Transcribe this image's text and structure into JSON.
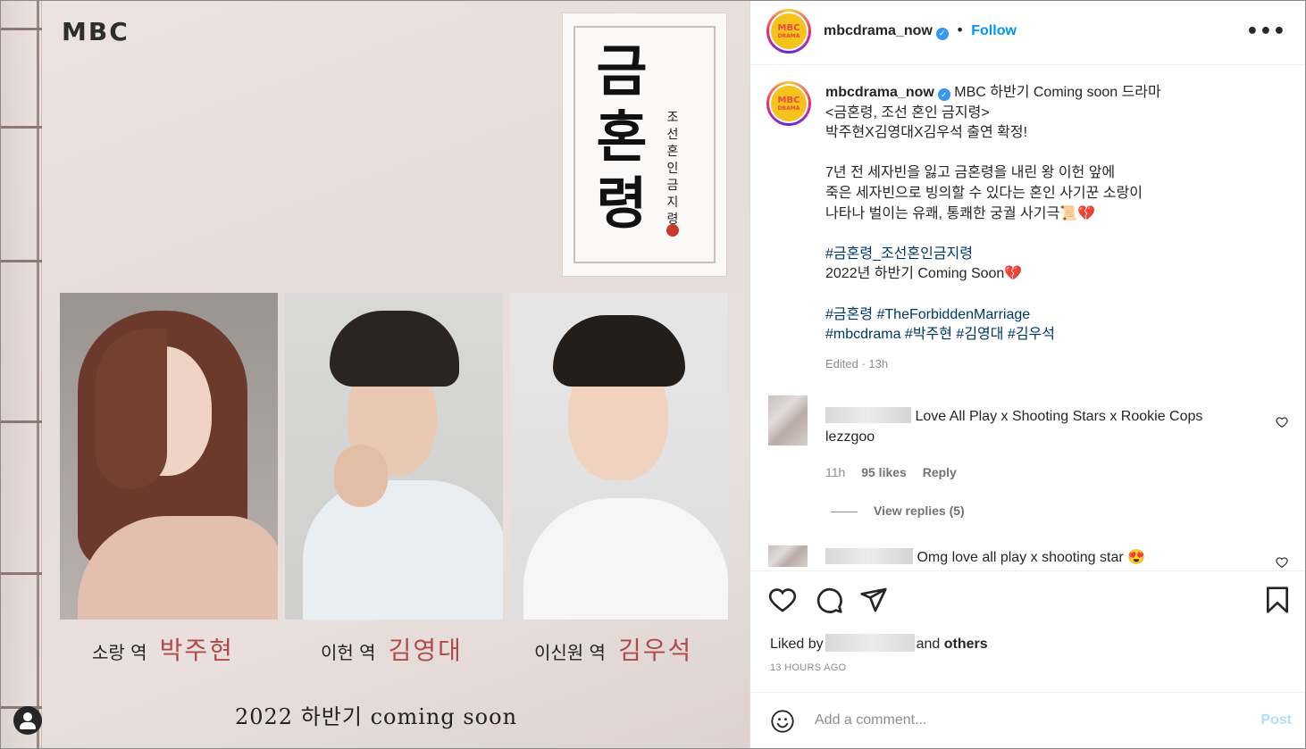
{
  "poster": {
    "logo": "MBC",
    "title_main": "금혼령",
    "title_sub": "조선혼인금지령",
    "roles": [
      {
        "role": "소랑 역",
        "name": "박주현"
      },
      {
        "role": "이헌 역",
        "name": "김영대"
      },
      {
        "role": "이신원 역",
        "name": "김우석"
      }
    ],
    "coming": "2022 하반기 coming soon"
  },
  "header": {
    "username": "mbcdrama_now",
    "follow": "Follow",
    "more": "•••",
    "avatar_line1": "MBC",
    "avatar_line2": "DRAMA"
  },
  "caption": {
    "username": "mbcdrama_now",
    "first_line": "MBC 하반기 Coming soon 드라마",
    "lines": [
      "<금혼령, 조선 혼인 금지령>",
      "박주현X김영대X김우석 출연 확정!",
      "",
      "7년 전 세자빈을 잃고 금혼령을 내린 왕 이헌 앞에",
      "죽은 세자빈으로 빙의할 수 있다는 혼인 사기꾼 소랑이",
      "나타나 벌이는 유쾌, 통쾌한 궁궐 사기극📜💔",
      ""
    ],
    "hashtag_title": "#금혼령_조선혼인금지령",
    "coming_line": "2022년 하반기 Coming Soon💔",
    "hashtags_1": "#금혼령 #TheForbiddenMarriage",
    "hashtags_2": "#mbcdrama #박주현 #김영대 #김우석",
    "edited": "Edited · 13h"
  },
  "comments": [
    {
      "text": "Love All Play x Shooting Stars x Rookie Cops",
      "text2": "lezzgoo",
      "time": "11h",
      "likes": "95 likes",
      "reply": "Reply",
      "view_replies": "View replies (5)"
    },
    {
      "text": "Omg love all play x shooting star 😍"
    }
  ],
  "actions": {
    "liked_by": "Liked by",
    "and_others": "and others",
    "others": "others",
    "time_ago": "13 HOURS AGO"
  },
  "add_comment": {
    "placeholder": "Add a comment...",
    "post": "Post"
  },
  "colors": {
    "accent": "#0095f6",
    "hashtag": "#00376b",
    "role_name": "#b04a4a"
  }
}
